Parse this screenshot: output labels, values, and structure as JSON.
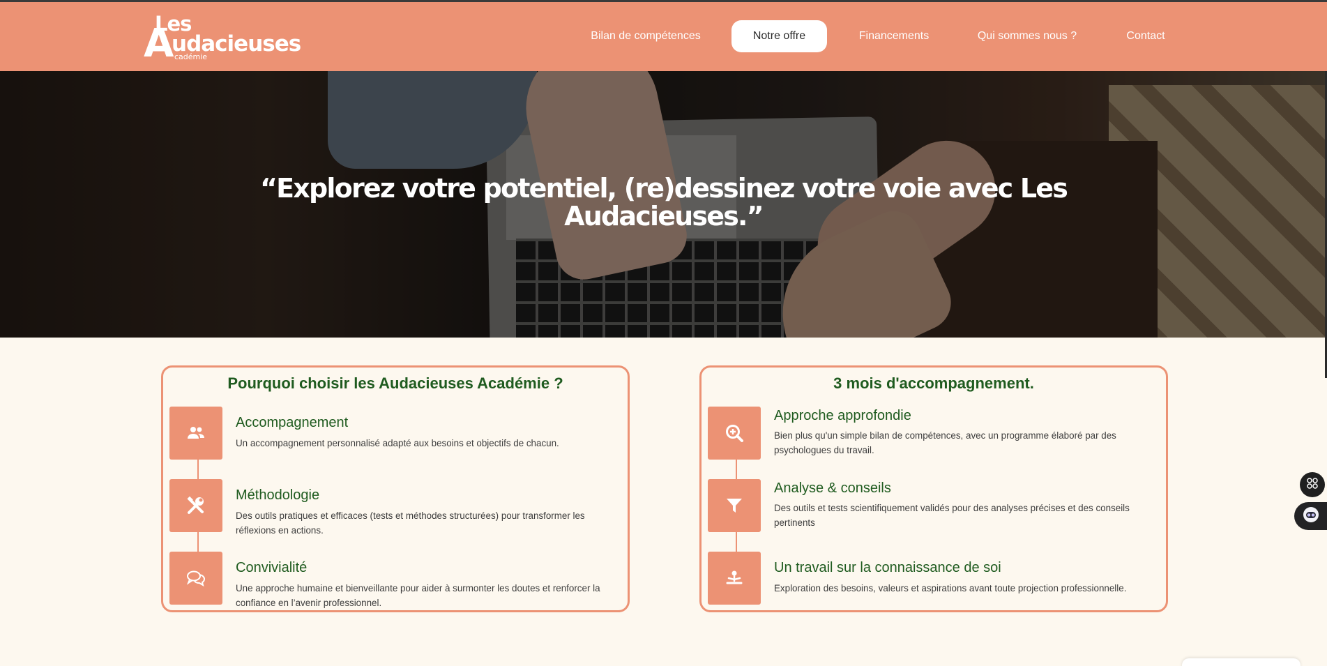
{
  "header": {
    "logo": {
      "line1": "Les",
      "initial": "A",
      "rest": "udacieuses",
      "sub": "cadémie"
    },
    "nav": [
      {
        "label": "Bilan de compétences",
        "active": false
      },
      {
        "label": "Notre offre",
        "active": true
      },
      {
        "label": "Financements",
        "active": false
      },
      {
        "label": "Qui sommes nous ?",
        "active": false
      },
      {
        "label": "Contact",
        "active": false
      }
    ]
  },
  "hero": {
    "quote": "“Explorez votre potentiel, (re)dessinez votre voie avec Les Audacieuses.”"
  },
  "cards": [
    {
      "title": "Pourquoi choisir les Audacieuses Académie ?",
      "items": [
        {
          "icon": "users-icon",
          "title": "Accompagnement",
          "description": "Un accompagnement personnalisé adapté aux besoins et objectifs de chacun."
        },
        {
          "icon": "tools-icon",
          "title": "Méthodologie",
          "description": "Des outils pratiques et efficaces (tests et méthodes structurées) pour transformer les réflexions en actions."
        },
        {
          "icon": "chat-icon",
          "title": "Convivialité",
          "description": "Une approche humaine et bienveillante pour aider à surmonter les doutes et renforcer la confiance en l’avenir professionnel."
        }
      ]
    },
    {
      "title": "3 mois d'accompagnement.",
      "items": [
        {
          "icon": "search-plus-icon",
          "title": "Approche approfondie",
          "description": "Bien plus qu'un simple bilan de compétences, avec un programme élaboré par des psychologues du travail."
        },
        {
          "icon": "filter-icon",
          "title": "Analyse & conseils",
          "description": "Des outils et tests scientifiquement validés pour des analyses précises et des conseils pertinents"
        },
        {
          "icon": "meditation-icon",
          "title": "Un travail sur la connaissance de soi",
          "description": "Exploration des besoins, valeurs et aspirations avant toute projection professionnelle."
        }
      ]
    }
  ],
  "colors": {
    "brand": "#ec9274",
    "heading": "#1f5b1f",
    "background": "#fdf8ef"
  },
  "widgets": [
    {
      "icon": "apps-icon"
    },
    {
      "icon": "chatbot-icon"
    }
  ]
}
